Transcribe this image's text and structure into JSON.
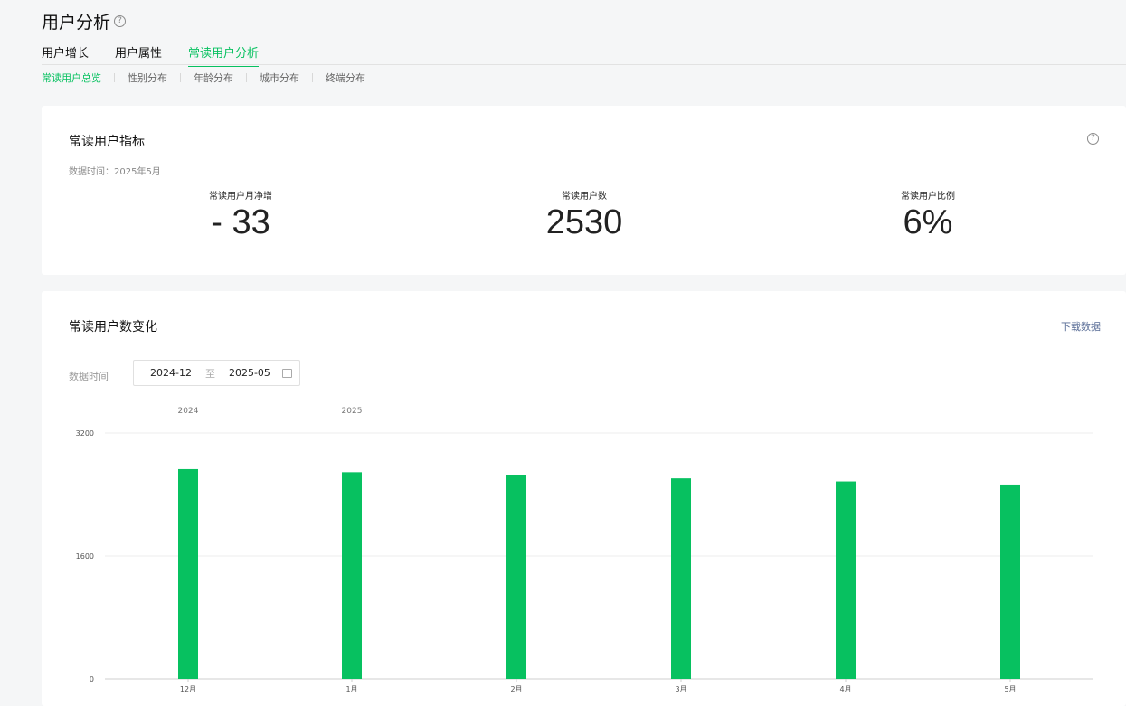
{
  "header": {
    "title": "用户分析",
    "tabs": [
      {
        "label": "用户增长",
        "active": false
      },
      {
        "label": "用户属性",
        "active": false
      },
      {
        "label": "常读用户分析",
        "active": true
      }
    ],
    "subtabs": [
      {
        "label": "常读用户总览",
        "active": true
      },
      {
        "label": "性别分布",
        "active": false
      },
      {
        "label": "年龄分布",
        "active": false
      },
      {
        "label": "城市分布",
        "active": false
      },
      {
        "label": "终端分布",
        "active": false
      }
    ]
  },
  "metrics_card": {
    "title": "常读用户指标",
    "data_time": "数据时间：2025年5月",
    "metrics": [
      {
        "label": "常读用户月净增",
        "value": "- 33"
      },
      {
        "label": "常读用户数",
        "value": "2530"
      },
      {
        "label": "常读用户比例",
        "value": "6%"
      }
    ]
  },
  "trend_card": {
    "title": "常读用户数变化",
    "download_label": "下载数据",
    "filter_label": "数据时间",
    "range_start": "2024-12",
    "range_to": "至",
    "range_end": "2025-05"
  },
  "colors": {
    "accent": "#07c160",
    "link": "#576b95"
  },
  "chart_data": {
    "type": "bar",
    "year_labels": [
      {
        "label": "2024",
        "at": "12月"
      },
      {
        "label": "2025",
        "at": "1月"
      }
    ],
    "categories": [
      "12月",
      "1月",
      "2月",
      "3月",
      "4月",
      "5月"
    ],
    "values": [
      2730,
      2690,
      2650,
      2610,
      2570,
      2530
    ],
    "yticks": [
      0,
      1600,
      3200
    ],
    "ylim": [
      0,
      3200
    ],
    "color": "#07c160",
    "grid": true
  }
}
